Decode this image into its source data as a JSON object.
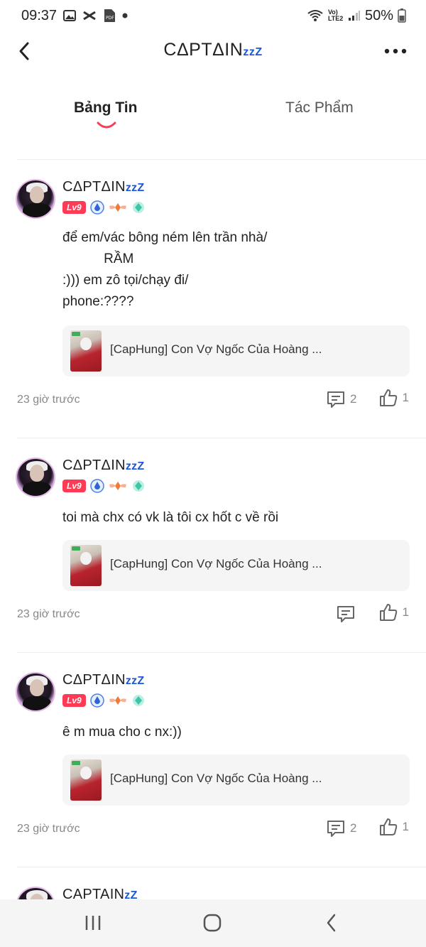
{
  "status_bar": {
    "time": "09:37",
    "battery": "50%",
    "network": "Vo) LTE2"
  },
  "header": {
    "title": "CΔPTΔIN",
    "title_suffix": "zzZ"
  },
  "tabs": [
    {
      "label": "Bảng Tin",
      "active": true
    },
    {
      "label": "Tác Phẩm",
      "active": false
    }
  ],
  "posts": [
    {
      "author": "CΔPTΔIN",
      "author_suffix": "zzZ",
      "level": "Lv9",
      "text": "để em/vác bông ném lên trần nhà/\n           RẦM\n:))) em zô tọi/chạy đi/\nphone:????",
      "work_title": "[CapHung] Con Vợ Ngốc Của Hoàng ...",
      "time": "23 giờ trước",
      "comments": "2",
      "likes": "1"
    },
    {
      "author": "CΔPTΔIN",
      "author_suffix": "zzZ",
      "level": "Lv9",
      "text": "toi mà chx có vk là tôi cx hốt c về rồi",
      "work_title": "[CapHung] Con Vợ Ngốc Của Hoàng ...",
      "time": "23 giờ trước",
      "comments": "",
      "likes": "1"
    },
    {
      "author": "CΔPTΔIN",
      "author_suffix": "zzZ",
      "level": "Lv9",
      "text": "ê m mua cho c nx:))",
      "work_title": "[CapHung] Con Vợ Ngốc Của Hoàng ...",
      "time": "23 giờ trước",
      "comments": "2",
      "likes": "1"
    }
  ],
  "peek_post": {
    "author": "CAPTAIN",
    "author_suffix": "zZ"
  },
  "colors": {
    "accent_red": "#ff3a55",
    "zz_blue": "#1a56d6",
    "indicator": "#ff3a55"
  }
}
